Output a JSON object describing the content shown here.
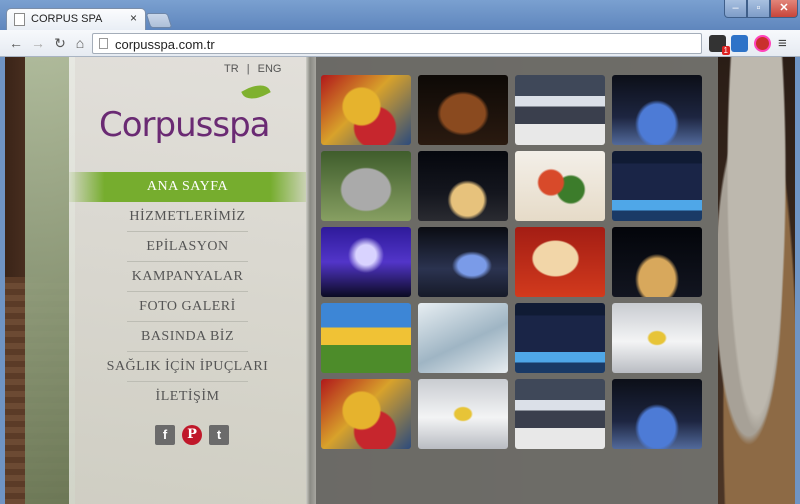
{
  "browser": {
    "tab_title": "CORPUS SPA",
    "tab_close": "×",
    "url": "corpusspa.com.tr",
    "window_controls": {
      "minimize": "–",
      "maximize": "▫",
      "close": "✕"
    },
    "nav_icons": {
      "back": "←",
      "forward": "→",
      "reload": "↻",
      "home": "⌂"
    },
    "menu_icon": "≡",
    "extension_badge": "1"
  },
  "site": {
    "lang": {
      "tr": "TR",
      "separator": "|",
      "eng": "ENG"
    },
    "logo_text": "Corpusspa",
    "nav": [
      {
        "label": "ANA SAYFA",
        "active": true
      },
      {
        "label": "HİZMETLERİMİZ"
      },
      {
        "label": "EPİLASYON"
      },
      {
        "label": "KAMPANYALAR"
      },
      {
        "label": "FOTO GALERİ"
      },
      {
        "label": "BASINDA BİZ"
      },
      {
        "label": "SAĞLIK İÇİN İPUÇLARI"
      },
      {
        "label": "İLETİŞİM"
      }
    ],
    "social": {
      "facebook": "f",
      "pinterest": "P",
      "twitter": "t"
    },
    "accent_color": "#76ad2e",
    "logo_color": "#6a2a73",
    "gallery": [
      "parrot-photo",
      "horse-photo",
      "tv-studio-photo",
      "stage-photo",
      "cat-photo",
      "night-city-photo",
      "food-photo",
      "led-tv-photo",
      "concert-photo",
      "stage-photo",
      "blonde-woman-photo",
      "night-city-photo",
      "flowers-photo",
      "swimmer-photo",
      "led-tv-photo",
      "airplane-photo",
      "parrot-photo",
      "airplane-photo",
      "tv-studio-photo",
      "stage-photo"
    ]
  }
}
